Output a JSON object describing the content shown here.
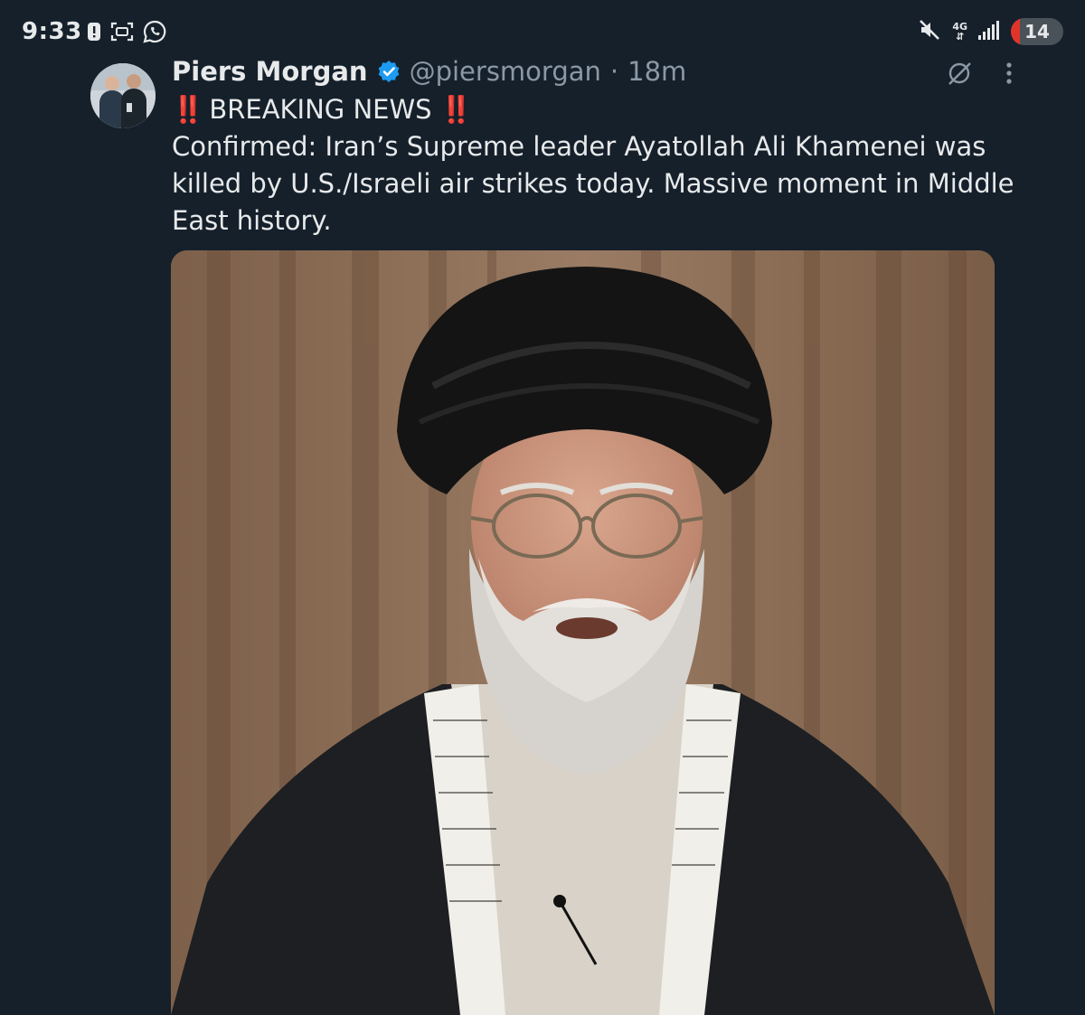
{
  "status_bar": {
    "time": "9:33",
    "network": "4G",
    "battery_level": "14",
    "icons": [
      "alert-icon",
      "screenshot-icon",
      "whatsapp-icon",
      "mute-icon",
      "data-arrows-icon",
      "signal-icon",
      "battery-icon"
    ]
  },
  "tweet": {
    "display_name": "Piers Morgan",
    "handle": "@piersmorgan",
    "separator": "·",
    "time_ago": "18m",
    "headline_prefix": "‼️",
    "headline": "BREAKING NEWS",
    "headline_suffix": "‼️",
    "body": "Confirmed: Iran’s Supreme leader Ayatollah Ali Khamenei was killed by U.S./Israeli air strikes today. Massive moment in Middle East history."
  },
  "colors": {
    "background": "#15202b",
    "text": "#e7e9ea",
    "muted": "#8b98a5",
    "verified": "#1d9bf0",
    "breaking": "#e0245e",
    "battery_low": "#e0342b"
  }
}
